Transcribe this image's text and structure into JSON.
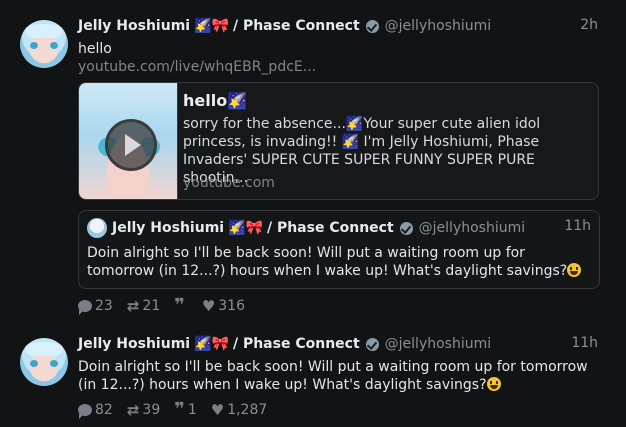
{
  "post1": {
    "display_name": "Jelly Hoshiumi",
    "name_emojis": "🌠🎀",
    "name_suffix": "/ Phase Connect",
    "handle": "@jellyhoshiumi",
    "time": "2h",
    "text": "hello",
    "link": "youtube.com/live/whqEBR_pdcE...",
    "card": {
      "title": "hello🌠",
      "description": "sorry for the absence...🌠Your super cute alien idol princess, is invading!! 🌠 I'm Jelly Hoshiumi, Phase Invaders' SUPER CUTE SUPER FUNNY SUPER PURE shootin...",
      "domain": "youtube.com"
    },
    "quote": {
      "display_name": "Jelly Hoshiumi",
      "name_emojis": "🌠🎀",
      "name_suffix": "/ Phase Connect",
      "handle": "@jellyhoshiumi",
      "time": "11h",
      "text": "Doin alright so I'll be back soon! Will put a waiting room up for tomorrow (in 12...?) hours when I wake up! What's daylight savings?"
    },
    "replies": "23",
    "boosts": "21",
    "quotes": "",
    "likes": "316"
  },
  "post2": {
    "display_name": "Jelly Hoshiumi",
    "name_emojis": "🌠🎀",
    "name_suffix": "/ Phase Connect",
    "handle": "@jellyhoshiumi",
    "time": "11h",
    "text": "Doin alright so I'll be back soon! Will put a waiting room up for tomorrow (in 12...?) hours when I wake up! What's daylight savings?",
    "replies": "82",
    "boosts": "39",
    "quotes": "1",
    "likes": "1,287"
  },
  "icons": {
    "reply": "speech-bubble",
    "boost": "repeat-arrows",
    "quote": "quote-marks",
    "like": "heart"
  }
}
